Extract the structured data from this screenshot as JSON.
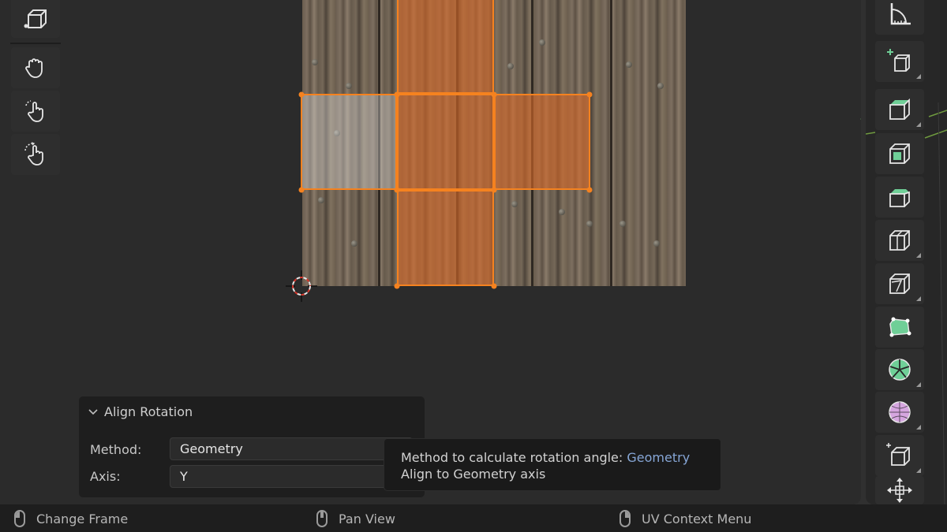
{
  "left_toolbar": {
    "tools": [
      {
        "name": "select-box-tool",
        "icon": "cube-select-icon"
      },
      {
        "name": "grab-tool",
        "icon": "hand-grab-icon"
      },
      {
        "name": "rotate-tool",
        "icon": "hand-rotate-icon"
      },
      {
        "name": "scale-tool",
        "icon": "hand-scale-icon"
      }
    ]
  },
  "right_toolbar": {
    "tools": [
      "measure-icon",
      "add-cube-icon",
      "extrude-region-icon",
      "inset-faces-icon",
      "bevel-icon",
      "loop-cut-icon",
      "knife-icon",
      "poly-build-icon",
      "spin-icon",
      "smooth-icon",
      "shear-icon",
      "transform-icon"
    ]
  },
  "operator_panel": {
    "title": "Align Rotation",
    "method_label": "Method:",
    "method_value": "Geometry",
    "axis_label": "Axis:",
    "axis_value": "Y"
  },
  "tooltip": {
    "line1_prefix": "Method to calculate rotation angle:",
    "line1_value": "Geometry",
    "line2": "Align to Geometry axis"
  },
  "status_bar": {
    "left": "Change Frame",
    "middle": "Pan View",
    "right": "UV Context Menu"
  },
  "colors": {
    "uv_selection": "#f5821f",
    "tooltip_accent": "#86a6d6",
    "gizmo_green": "#6fcf97"
  }
}
